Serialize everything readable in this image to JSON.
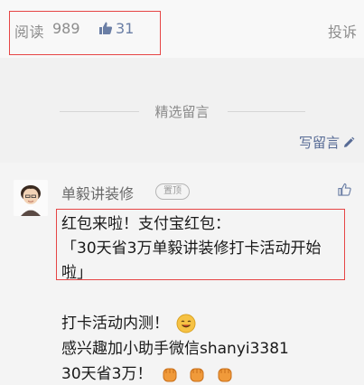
{
  "stats": {
    "read_label": "阅读",
    "read_count": "989",
    "like_count": "31",
    "report": "投诉"
  },
  "section": {
    "title": "精选留言",
    "write_comment": "写留言"
  },
  "comment": {
    "author": "单毅讲装修",
    "pinned_badge": "置顶",
    "lines": [
      "红包来啦！支付宝红包：",
      "「30天省3万单毅讲装修打卡活动开始",
      "啦」",
      "",
      "打卡活动内测！",
      "感兴趣加小助手微信shanyi3381",
      "30天省3万！"
    ]
  },
  "colors": {
    "highlight_border": "#e64545",
    "link": "#576b95",
    "emoji_yellow": "#f6c244",
    "emoji_fist": "#f09a3a"
  }
}
